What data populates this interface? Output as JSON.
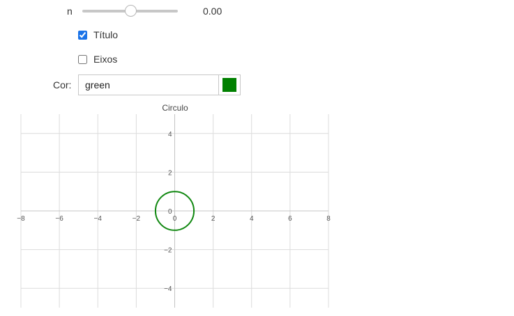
{
  "slider": {
    "label": "n",
    "value_text": "0.00",
    "fraction": 0.51
  },
  "checkboxes": {
    "titulo": {
      "label": "Título",
      "checked": true
    },
    "eixos": {
      "label": "Eixos",
      "checked": false
    }
  },
  "color": {
    "label": "Cor:",
    "value": "green",
    "swatch_hex": "#008000"
  },
  "chart_data": {
    "type": "line",
    "title": "Circulo",
    "xlabel": "",
    "ylabel": "",
    "xlim": [
      -8,
      8
    ],
    "ylim": [
      -5,
      5
    ],
    "x_ticks": [
      -8,
      -6,
      -4,
      -2,
      0,
      2,
      4,
      6,
      8
    ],
    "y_ticks": [
      -4,
      -2,
      0,
      2,
      4
    ],
    "grid": true,
    "series": [
      {
        "shape": "circle",
        "center": [
          0,
          0
        ],
        "radius": 1,
        "color": "#118811"
      }
    ]
  }
}
